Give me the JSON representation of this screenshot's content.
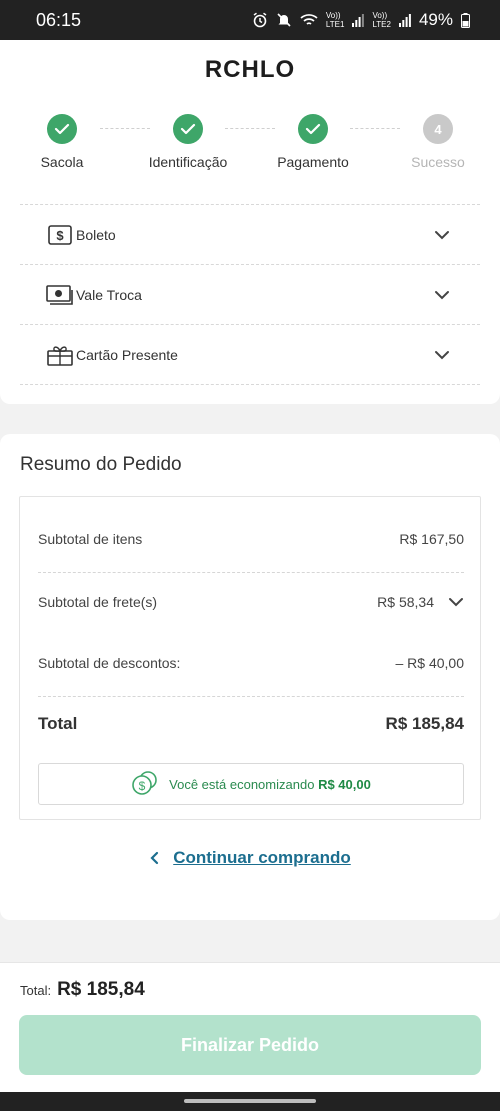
{
  "status_bar": {
    "time": "06:15",
    "battery": "49%",
    "icons": [
      "alarm-icon",
      "mute-icon",
      "wifi-icon",
      "volte-lte1-icon",
      "signal-icon",
      "volte-lte2-icon",
      "signal-icon",
      "battery-icon"
    ],
    "volte1": "Vo))",
    "lte1": "LTE1",
    "volte2": "Vo))",
    "lte2": "LTE2"
  },
  "header": {
    "logo": "RCHLO"
  },
  "steps": [
    {
      "label": "Sacola",
      "state": "done"
    },
    {
      "label": "Identificação",
      "state": "done"
    },
    {
      "label": "Pagamento",
      "state": "done"
    },
    {
      "label": "Sucesso",
      "state": "pending",
      "number": "4"
    }
  ],
  "payment_methods": [
    {
      "label": "Boleto",
      "icon": "boleto-icon"
    },
    {
      "label": "Vale Troca",
      "icon": "voucher-icon"
    },
    {
      "label": "Cartão Presente",
      "icon": "gift-card-icon"
    }
  ],
  "summary": {
    "title": "Resumo do Pedido",
    "items_label": "Subtotal de itens",
    "items_value": "R$ 167,50",
    "shipping_label": "Subtotal de frete(s)",
    "shipping_value": "R$ 58,34",
    "discount_label": "Subtotal de descontos:",
    "discount_value": "– R$ 40,00",
    "total_label": "Total",
    "total_value": "R$ 185,84",
    "saving_text": "Você está economizando",
    "saving_value": "R$ 40,00"
  },
  "continue_link": "Continuar comprando",
  "footer": {
    "total_label": "Total:",
    "total_value": "R$ 185,84",
    "button_label": "Finalizar Pedido"
  },
  "colors": {
    "accent_green": "#3ea669",
    "link_blue": "#1c6e8f",
    "button_disabled": "#b3e2cc"
  }
}
